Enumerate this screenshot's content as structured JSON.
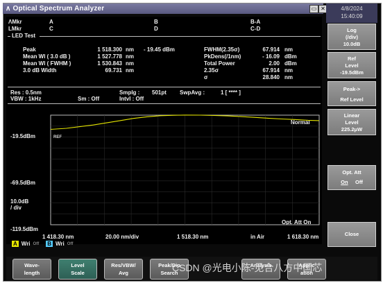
{
  "window": {
    "title": "Optical Spectrum Analyzer",
    "icon": "caret-icon"
  },
  "datetime": {
    "date": "4/8/2024",
    "time": "15:40:09"
  },
  "markers": {
    "amkr": "ΛMkr",
    "lmkr": "LMkr",
    "a": "A",
    "b": "B",
    "c": "C",
    "d": "D",
    "ba": "B-A",
    "cd": "C-D"
  },
  "led_test": {
    "header": "LED Test",
    "left": [
      {
        "label": "Peak",
        "value": "1 518.300",
        "unit": "nm",
        "extra": "- 19.45 dBm"
      },
      {
        "label": "Mean Wl  (  3.0  dB )",
        "value": "1 527.778",
        "unit": "nm",
        "extra": ""
      },
      {
        "label": "Mean Wl  ( FWHM )",
        "value": "1 530.843",
        "unit": "nm",
        "extra": ""
      },
      {
        "label": "3.0    dB Width",
        "value": "69.731",
        "unit": "nm",
        "extra": ""
      }
    ],
    "right": [
      {
        "label": "FWHM(2.35σ)",
        "value": "67.914",
        "unit": "nm"
      },
      {
        "label": "PkDens(/1nm)",
        "value": "- 16.09",
        "unit": "dBm"
      },
      {
        "label": "Total Power",
        "value": "2.00",
        "unit": "dBm"
      },
      {
        "label": "2.35σ",
        "value": "67.914",
        "unit": "nm"
      },
      {
        "label": "σ",
        "value": "28.840",
        "unit": "nm"
      }
    ]
  },
  "settings": {
    "res": "Res : 0.5nm",
    "vbw": "VBW :  1kHz",
    "sm": "Sm :  Off",
    "smplg": "Smplg :",
    "smplg_val": "501pt",
    "intvl": "Intvl :   Off",
    "swpavg": "SwpAvg :",
    "swpavg_val": "1 [     ****  ]"
  },
  "plot": {
    "mode": "Normal",
    "ref_tag": "REF",
    "y_top": "-19.5dBm",
    "y_mid": "-69.5dBm",
    "scale": "10.0dB",
    "scale_unit": "/ div",
    "y_bottom": "-119.5dBm",
    "opt_att": "Opt. Att On",
    "x_start": "1 418.30 nm",
    "x_div": "20.00 nm/div",
    "x_center": "1 518.30 nm",
    "x_medium": "in Air",
    "x_stop": "1 618.30 nm",
    "trace_a": "A",
    "trace_a_state": "Wri",
    "trace_a_disp": "Off",
    "trace_b": "B",
    "trace_b_state": "Wri",
    "trace_b_disp": "Off",
    "trace_color": "#e6e600"
  },
  "chart_data": {
    "type": "line",
    "title": "",
    "xlabel": "",
    "ylabel": "",
    "xlim": [
      1418.3,
      1618.3
    ],
    "ylim": [
      -119.5,
      -19.5
    ],
    "series": [
      {
        "name": "",
        "x": [
          1418.3,
          1430,
          1440,
          1450,
          1460,
          1470,
          1480,
          1490,
          1500,
          1510,
          1518.3,
          1530,
          1540,
          1550,
          1560,
          1570,
          1580,
          1590,
          1600,
          1610,
          1618.3
        ],
        "y": [
          -32.5,
          -31.5,
          -30.0,
          -28.5,
          -26.5,
          -24.5,
          -22.5,
          -21.0,
          -20.0,
          -19.6,
          -19.45,
          -19.5,
          -19.8,
          -20.2,
          -20.8,
          -21.5,
          -22.3,
          -23.0,
          -23.5,
          -24.2,
          -24.5
        ]
      }
    ]
  },
  "side_buttons": [
    {
      "l1": "Log",
      "l2": "(/div)",
      "l3": "10.0dB"
    },
    {
      "l1": "Ref",
      "l2": "Level",
      "l3": "-19.5dBm"
    },
    {
      "l1": "Peak->",
      "l2": "Ref Level",
      "l3": ""
    },
    {
      "l1": "Linear",
      "l2": "Level",
      "l3": "225.2μW"
    },
    {
      "l1": "Opt. Att",
      "l2": "On",
      "l3": "Off"
    },
    {
      "l1": "Close",
      "l2": "",
      "l3": ""
    }
  ],
  "bottom_buttons": [
    {
      "l1": "Wave-",
      "l2": "length"
    },
    {
      "l1": "Level",
      "l2": "Scale"
    },
    {
      "l1": "Res/VBW/",
      "l2": "Avg"
    },
    {
      "l1": "Peak/Dip",
      "l2": "Search"
    },
    {
      "l1": "Analysis",
      "l2": ""
    },
    {
      "l1": "Applic",
      "l2": "ation"
    }
  ],
  "watermark": "CSDN @光电小陈-见合八方中国芯"
}
